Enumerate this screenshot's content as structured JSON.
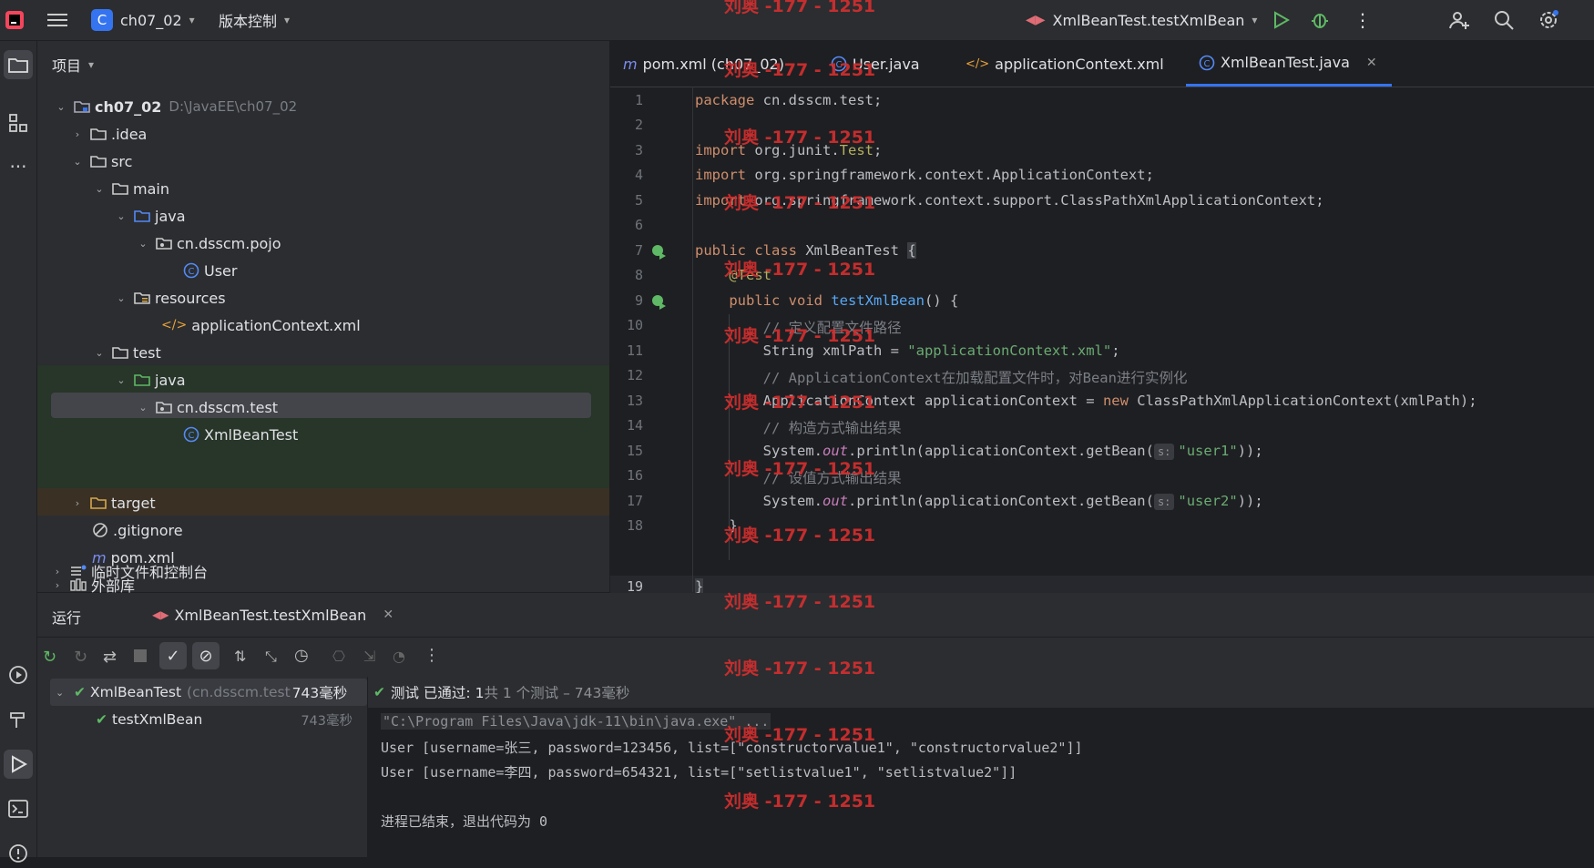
{
  "titlebar": {
    "project_letter": "C",
    "project_name": "ch07_02",
    "vcs_label": "版本控制",
    "run_config": "XmlBeanTest.testXmlBean"
  },
  "project_panel": {
    "title": "项目",
    "tree": [
      {
        "label": "ch07_02",
        "path": "D:\\JavaEE\\ch07_02"
      },
      {
        "label": ".idea"
      },
      {
        "label": "src"
      },
      {
        "label": "main"
      },
      {
        "label": "java"
      },
      {
        "label": "cn.dsscm.pojo"
      },
      {
        "label": "User"
      },
      {
        "label": "resources"
      },
      {
        "label": "applicationContext.xml"
      },
      {
        "label": "test"
      },
      {
        "label": "java"
      },
      {
        "label": "cn.dsscm.test"
      },
      {
        "label": "XmlBeanTest"
      },
      {
        "label": "target"
      },
      {
        "label": ".gitignore"
      },
      {
        "label": "pom.xml"
      },
      {
        "label": "外部库"
      },
      {
        "label": "临时文件和控制台"
      }
    ]
  },
  "editor": {
    "tabs": [
      {
        "label": "pom.xml (ch07_02)"
      },
      {
        "label": "User.java"
      },
      {
        "label": "applicationContext.xml"
      },
      {
        "label": "XmlBeanTest.java"
      }
    ],
    "line_numbers": [
      "1",
      "2",
      "3",
      "4",
      "5",
      "6",
      "7",
      "8",
      "9",
      "10",
      "11",
      "12",
      "13",
      "14",
      "15",
      "16",
      "17",
      "18",
      "19"
    ],
    "code": {
      "l1a": "package",
      "l1b": " cn.dsscm.test;",
      "l3a": "import",
      "l3b": " org.junit.",
      "l3c": "Test",
      "l3d": ";",
      "l4a": "import",
      "l4b": " org.springframework.context.ApplicationContext;",
      "l5a": "import",
      "l5b": " org.springframework.context.support.ClassPathXmlApplicationContext;",
      "l7a": "public class",
      "l7b": " XmlBeanTest ",
      "l7c": "{",
      "l8": "    @Test",
      "l9a": "    public void ",
      "l9b": "testXmlBean",
      "l9c": "() {",
      "l10": "        // 定义配置文件路径",
      "l11a": "        String xmlPath = ",
      "l11b": "\"applicationContext.xml\"",
      "l11c": ";",
      "l12": "        // ApplicationContext在加载配置文件时，对Bean进行实例化",
      "l13a": "        ApplicationContext applicationContext = ",
      "l13b": "new",
      "l13c": " ClassPathXmlApplicationContext(xmlPath);",
      "l14": "        // 构造方式输出结果",
      "l15a": "        System.",
      "l15b": "out",
      "l15c": ".println(applicationContext.getBean(",
      "l15hint": "s:",
      "l15d": "\"user1\"",
      "l15e": "));",
      "l16": "        // 设值方式输出结果",
      "l17a": "        System.",
      "l17b": "out",
      "l17c": ".println(applicationContext.getBean(",
      "l17hint": "s:",
      "l17d": "\"user2\"",
      "l17e": "));",
      "l18": "    }",
      "l19": "}"
    }
  },
  "run_panel": {
    "title": "运行",
    "tab_label": "XmlBeanTest.testXmlBean",
    "status_passed": "测试 已通过: 1",
    "status_detail": "共 1 个测试 – 743毫秒",
    "tests": [
      {
        "name": "XmlBeanTest",
        "pkg": "(cn.dsscm.test",
        "time": "743毫秒"
      },
      {
        "name": "testXmlBean",
        "time": "743毫秒"
      }
    ],
    "console": [
      "\"C:\\Program Files\\Java\\jdk-11\\bin\\java.exe\" ...",
      "User [username=张三, password=123456, list=[\"constructorvalue1\", \"constructorvalue2\"]]",
      "User [username=李四, password=654321, list=[\"setlistvalue1\", \"setlistvalue2\"]]",
      "",
      "进程已结束，退出代码为 0"
    ]
  },
  "watermark": "刘奥 -177 - 1251"
}
